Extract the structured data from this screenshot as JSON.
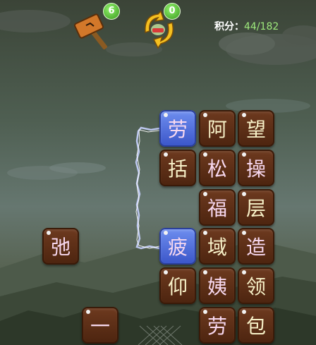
{
  "hud": {
    "hammer_count": "6",
    "shuffle_count": "0",
    "score_label": "积分：",
    "score_value": "44/182"
  },
  "colors": {
    "tile": "#5c2e16",
    "tile_selected": "#4a6ae0",
    "badge": "#4caf2a",
    "score_value": "#9eea7c"
  },
  "tiles": [
    {
      "char": "劳",
      "color": "#f7d8ef",
      "selected": true
    },
    {
      "char": "阿",
      "color": "#f7f1c8",
      "selected": false
    },
    {
      "char": "望",
      "color": "#f7f1c8",
      "selected": false
    },
    {
      "char": "括",
      "color": "#f7f1c8",
      "selected": false
    },
    {
      "char": "松",
      "color": "#f7d8ef",
      "selected": false
    },
    {
      "char": "操",
      "color": "#f7d8ef",
      "selected": false
    },
    {
      "char": "福",
      "color": "#f7d8ef",
      "selected": false
    },
    {
      "char": "层",
      "color": "#f7f1c8",
      "selected": false
    },
    {
      "char": "弛",
      "color": "#f7d8ef",
      "selected": false
    },
    {
      "char": "疲",
      "color": "#f7d8ef",
      "selected": true
    },
    {
      "char": "域",
      "color": "#f7f1c8",
      "selected": false
    },
    {
      "char": "造",
      "color": "#f7d8ef",
      "selected": false
    },
    {
      "char": "仰",
      "color": "#f7f1c8",
      "selected": false
    },
    {
      "char": "姨",
      "color": "#f7d8ef",
      "selected": false
    },
    {
      "char": "领",
      "color": "#f7f1c8",
      "selected": false
    },
    {
      "char": "一",
      "color": "#f7d8ef",
      "selected": false
    },
    {
      "char": "劳",
      "color": "#f7d8ef",
      "selected": false
    },
    {
      "char": "包",
      "color": "#f7f1c8",
      "selected": false
    }
  ]
}
